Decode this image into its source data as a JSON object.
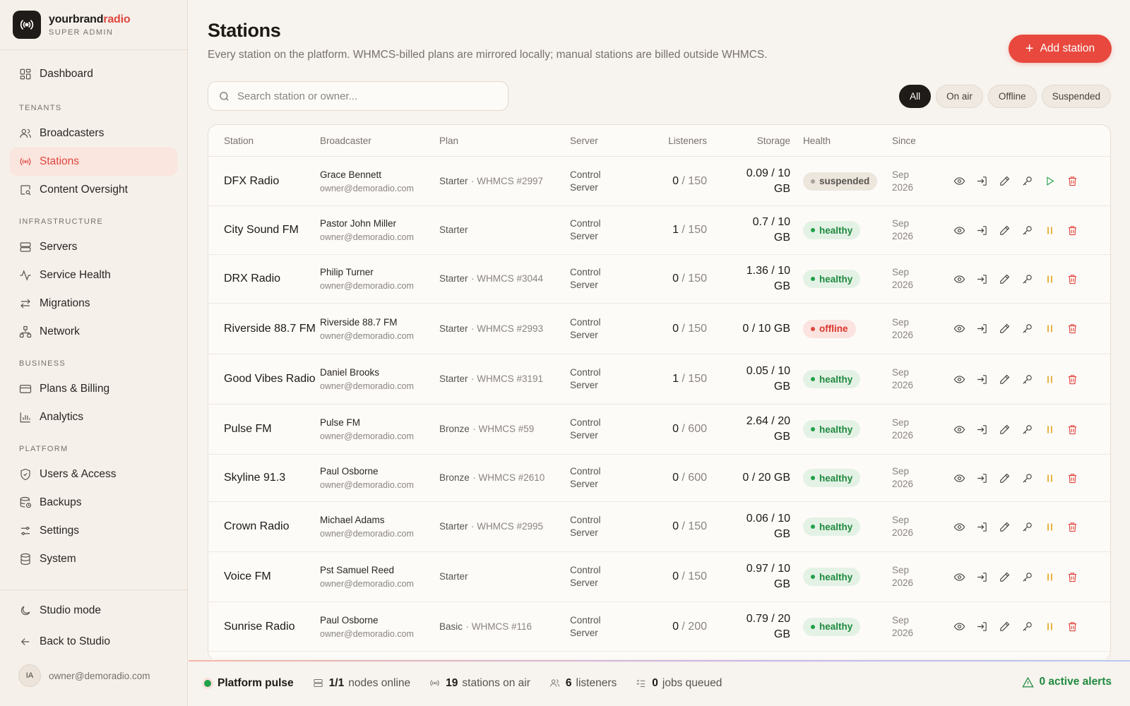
{
  "brand": {
    "name_main": "yourbrand",
    "name_accent": "radio",
    "role": "SUPER ADMIN"
  },
  "sidebar": {
    "dashboard": "Dashboard",
    "sections": [
      {
        "title": "TENANTS",
        "items": [
          {
            "label": "Broadcasters",
            "icon": "users-icon"
          },
          {
            "label": "Stations",
            "icon": "radio-icon",
            "active": true
          },
          {
            "label": "Content Oversight",
            "icon": "content-oversight-icon"
          }
        ]
      },
      {
        "title": "INFRASTRUCTURE",
        "items": [
          {
            "label": "Servers",
            "icon": "server-icon"
          },
          {
            "label": "Service Health",
            "icon": "activity-icon"
          },
          {
            "label": "Migrations",
            "icon": "arrows-icon"
          },
          {
            "label": "Network",
            "icon": "network-icon"
          }
        ]
      },
      {
        "title": "BUSINESS",
        "items": [
          {
            "label": "Plans & Billing",
            "icon": "credit-card-icon"
          },
          {
            "label": "Analytics",
            "icon": "bar-chart-icon"
          }
        ]
      },
      {
        "title": "PLATFORM",
        "items": [
          {
            "label": "Users & Access",
            "icon": "shield-icon"
          },
          {
            "label": "Backups",
            "icon": "database-clock-icon"
          },
          {
            "label": "Settings",
            "icon": "sliders-icon"
          },
          {
            "label": "System",
            "icon": "database-icon"
          }
        ]
      }
    ],
    "studio_mode": "Studio mode",
    "back_to_studio": "Back to Studio",
    "user_initials": "IA",
    "user_email": "owner@demoradio.com"
  },
  "page": {
    "title": "Stations",
    "subtitle": "Every station on the platform. WHMCS-billed plans are mirrored locally; manual stations are billed outside WHMCS.",
    "add_button": "Add station",
    "search_placeholder": "Search station or owner...",
    "filters": [
      {
        "label": "All",
        "active": true
      },
      {
        "label": "On air",
        "active": false
      },
      {
        "label": "Offline",
        "active": false
      },
      {
        "label": "Suspended",
        "active": false
      }
    ]
  },
  "table": {
    "columns": [
      "Station",
      "Broadcaster",
      "Plan",
      "Server",
      "Listeners",
      "Storage",
      "Health",
      "Since"
    ],
    "rows": [
      {
        "station": "DFX Radio",
        "owner": "Grace Bennett",
        "email": "owner@demoradio.com",
        "plan": "Starter",
        "whmcs": "· WHMCS #2997",
        "server": "Control Server",
        "listeners": "0",
        "cap": " / 150",
        "storage": "0.09 / 10 GB",
        "health": "suspended",
        "since": "Sep 2026",
        "toggle": "play"
      },
      {
        "station": "City Sound FM",
        "owner": "Pastor John Miller",
        "email": "owner@demoradio.com",
        "plan": "Starter",
        "whmcs": "",
        "server": "Control Server",
        "listeners": "1",
        "cap": " / 150",
        "storage": "0.7 / 10 GB",
        "health": "healthy",
        "since": "Sep 2026",
        "toggle": "pause"
      },
      {
        "station": "DRX Radio",
        "owner": "Philip Turner",
        "email": "owner@demoradio.com",
        "plan": "Starter",
        "whmcs": "· WHMCS #3044",
        "server": "Control Server",
        "listeners": "0",
        "cap": " / 150",
        "storage": "1.36 / 10 GB",
        "health": "healthy",
        "since": "Sep 2026",
        "toggle": "pause"
      },
      {
        "station": "Riverside 88.7 FM",
        "owner": "Riverside 88.7 FM",
        "email": "owner@demoradio.com",
        "plan": "Starter",
        "whmcs": "· WHMCS #2993",
        "server": "Control Server",
        "listeners": "0",
        "cap": " / 150",
        "storage": "0 / 10 GB",
        "health": "offline",
        "since": "Sep 2026",
        "toggle": "pause"
      },
      {
        "station": "Good Vibes Radio",
        "owner": "Daniel Brooks",
        "email": "owner@demoradio.com",
        "plan": "Starter",
        "whmcs": "· WHMCS #3191",
        "server": "Control Server",
        "listeners": "1",
        "cap": " / 150",
        "storage": "0.05 / 10 GB",
        "health": "healthy",
        "since": "Sep 2026",
        "toggle": "pause"
      },
      {
        "station": "Pulse FM",
        "owner": "Pulse FM",
        "email": "owner@demoradio.com",
        "plan": "Bronze",
        "whmcs": "· WHMCS #59",
        "server": "Control Server",
        "listeners": "0",
        "cap": " / 600",
        "storage": "2.64 / 20 GB",
        "health": "healthy",
        "since": "Sep 2026",
        "toggle": "pause"
      },
      {
        "station": "Skyline 91.3",
        "owner": "Paul Osborne",
        "email": "owner@demoradio.com",
        "plan": "Bronze",
        "whmcs": "· WHMCS #2610",
        "server": "Control Server",
        "listeners": "0",
        "cap": " / 600",
        "storage": "0 / 20 GB",
        "health": "healthy",
        "since": "Sep 2026",
        "toggle": "pause"
      },
      {
        "station": "Crown Radio",
        "owner": "Michael Adams",
        "email": "owner@demoradio.com",
        "plan": "Starter",
        "whmcs": "· WHMCS #2995",
        "server": "Control Server",
        "listeners": "0",
        "cap": " / 150",
        "storage": "0.06 / 10 GB",
        "health": "healthy",
        "since": "Sep 2026",
        "toggle": "pause"
      },
      {
        "station": "Voice FM",
        "owner": "Pst Samuel Reed",
        "email": "owner@demoradio.com",
        "plan": "Starter",
        "whmcs": "",
        "server": "Control Server",
        "listeners": "0",
        "cap": " / 150",
        "storage": "0.97 / 10 GB",
        "health": "healthy",
        "since": "Sep 2026",
        "toggle": "pause"
      },
      {
        "station": "Sunrise Radio",
        "owner": "Paul Osborne",
        "email": "owner@demoradio.com",
        "plan": "Basic",
        "whmcs": "· WHMCS #116",
        "server": "Control Server",
        "listeners": "0",
        "cap": " / 200",
        "storage": "0.79 / 20 GB",
        "health": "healthy",
        "since": "Sep 2026",
        "toggle": "pause"
      }
    ]
  },
  "pulse": {
    "title": "Platform pulse",
    "nodes_num": "1/1",
    "nodes_label": "nodes online",
    "stations_num": "19",
    "stations_label": "stations on air",
    "listeners_num": "6",
    "listeners_label": "listeners",
    "jobs_num": "0",
    "jobs_label": "jobs queued",
    "alerts": "0 active alerts"
  }
}
